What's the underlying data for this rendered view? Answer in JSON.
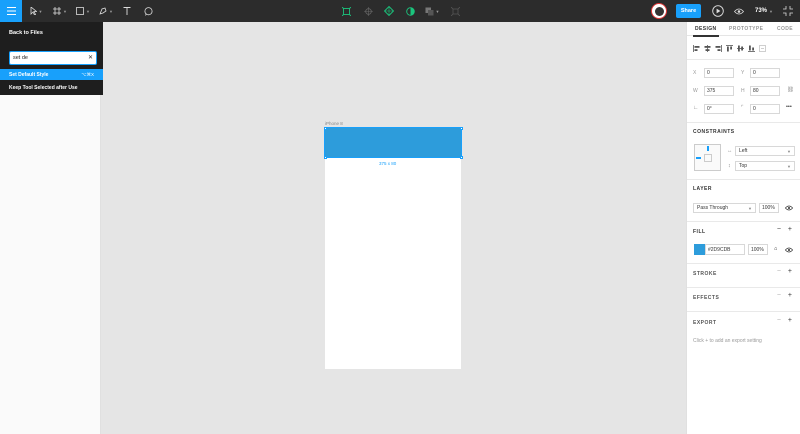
{
  "toolbar": {
    "share_label": "Share",
    "zoom": "73%"
  },
  "menu": {
    "back_label": "Back to Files",
    "search_value": "set de",
    "items": [
      {
        "label": "Set Default Style",
        "shortcut": "⌥⌘X",
        "active": true
      },
      {
        "label": "Keep Tool Selected after Use",
        "shortcut": "",
        "active": false
      }
    ]
  },
  "canvas": {
    "frame_name": "iPhone 8",
    "size_label": "375 x 80",
    "rect_color": "#2D9CDB"
  },
  "panel": {
    "tabs": [
      "DESIGN",
      "PROTOTYPE",
      "CODE"
    ],
    "x": "0",
    "y": "0",
    "w": "375",
    "h": "80",
    "rotation": "0°",
    "radius": "0",
    "labels": {
      "x": "X",
      "y": "Y",
      "w": "W",
      "h": "H"
    },
    "constraints_title": "CONSTRAINTS",
    "constraint_h": "Left",
    "constraint_v": "Top",
    "layer_title": "LAYER",
    "blend_mode": "Pass Through",
    "layer_opacity": "100%",
    "fill_title": "FILL",
    "fill_hex": "#2D9CDB",
    "fill_opacity": "100%",
    "stroke_title": "STROKE",
    "effects_title": "EFFECTS",
    "export_title": "EXPORT",
    "export_hint": "Click + to add an export setting"
  }
}
